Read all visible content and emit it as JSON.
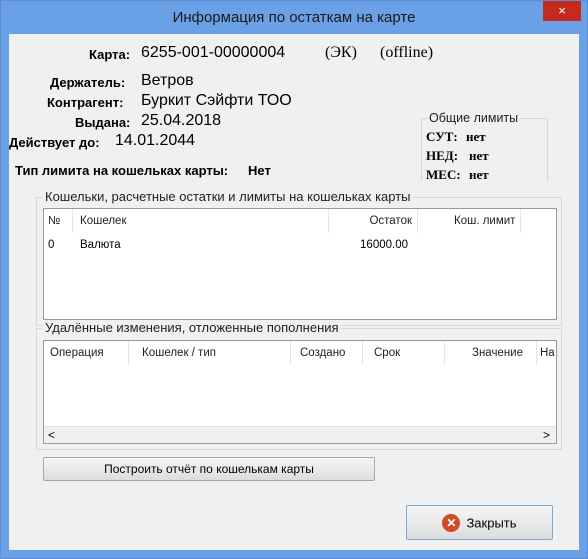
{
  "window": {
    "title": "Информация по остаткам на карте",
    "close_glyph": "×"
  },
  "card": {
    "card_label": "Карта:",
    "card_number": "6255-001-00000004",
    "card_type": "(ЭК)",
    "card_mode": "(offline)",
    "holder_label": "Держатель:",
    "holder_value": "Ветров",
    "counterparty_label": "Контрагент:",
    "counterparty_value": "Буркит Сэйфти ТОО",
    "issued_label": "Выдана:",
    "issued_value": "25.04.2018",
    "valid_label": "Действует до:",
    "valid_value": "14.01.2044",
    "limit_type_label": "Тип лимита на кошельках карты:",
    "limit_type_value": "Нет"
  },
  "general_limits": {
    "title": "Общие лимиты",
    "items": [
      {
        "label": "СУТ:",
        "value": "нет"
      },
      {
        "label": "НЕД:",
        "value": "нет"
      },
      {
        "label": "МЕС:",
        "value": "нет"
      }
    ]
  },
  "wallets": {
    "title": "Кошельки, расчетные остатки и лимиты на кошельках карты",
    "columns": [
      "№",
      "Кошелек",
      "Остаток",
      "Кош. лимит"
    ],
    "rows": [
      {
        "num": "0",
        "wallet": "Валюта",
        "balance": "16000.00",
        "limit": ""
      }
    ]
  },
  "remote_changes": {
    "title": "Удалённые изменения, отложенные пополнения",
    "columns": [
      "Операция",
      "Кошелек / тип",
      "Создано",
      "Срок",
      "Значение",
      "На"
    ],
    "rows": [],
    "scroll_left": "<",
    "scroll_right": ">"
  },
  "buttons": {
    "report_label": "Построить отчёт по кошелькам карты",
    "close_label": "Закрыть"
  },
  "colors": {
    "titlebar": "#6aa0e6",
    "close_button": "#c42b1c",
    "dialog_bg": "#f0f0f0",
    "close_icon": "#d04a2e"
  }
}
